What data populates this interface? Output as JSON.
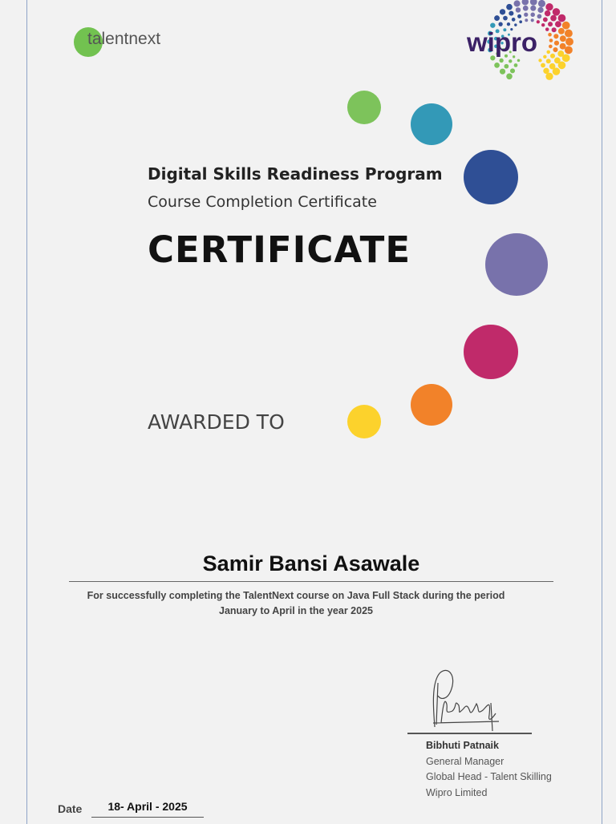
{
  "logos": {
    "talentnext": "talentnext",
    "wipro": "wipro"
  },
  "header": {
    "program": "Digital Skills Readiness Program",
    "subtitle": "Course Completion Certificate",
    "title": "CERTIFICATE"
  },
  "awarded_label": "AWARDED TO",
  "recipient": "Samir Bansi Asawale",
  "description": "For successfully completing the TalentNext course on Java Full Stack during the period January to April in the year 2025",
  "signatory": {
    "name": "Bibhuti Patnaik",
    "role": "General Manager",
    "title": "Global Head - Talent Skilling",
    "company": "Wipro Limited"
  },
  "date": {
    "label": "Date",
    "value": "18- April - 2025"
  },
  "colors": {
    "green": "#7dc35b",
    "teal": "#3399b7",
    "navy": "#2f4f95",
    "purple": "#7872ab",
    "magenta": "#c02a6a",
    "orange": "#f28229",
    "yellow": "#fcd22c"
  }
}
